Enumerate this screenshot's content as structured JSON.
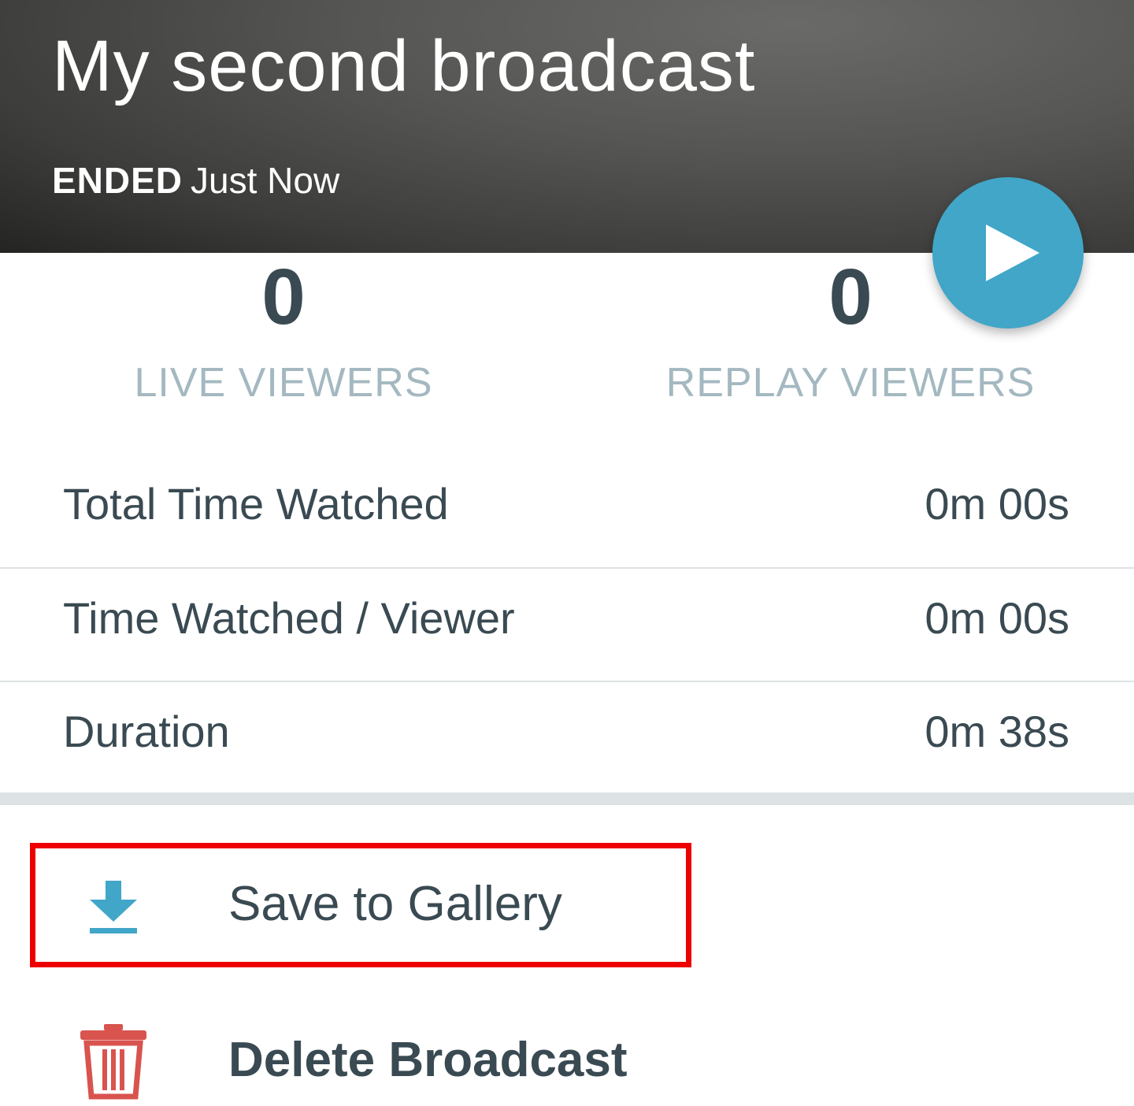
{
  "header": {
    "title": "My second broadcast",
    "status": "ENDED",
    "time": "Just Now",
    "play_icon": "play-icon"
  },
  "stats": {
    "live": {
      "value": "0",
      "label": "LIVE VIEWERS"
    },
    "replay": {
      "value": "0",
      "label": "REPLAY VIEWERS"
    }
  },
  "metrics": [
    {
      "label": "Total Time Watched",
      "value": "0m 00s"
    },
    {
      "label": "Time Watched / Viewer",
      "value": "0m 00s"
    },
    {
      "label": "Duration",
      "value": "0m 38s"
    }
  ],
  "actions": {
    "save": {
      "label": "Save to Gallery",
      "icon": "download-icon"
    },
    "delete": {
      "label": "Delete Broadcast",
      "icon": "trash-icon"
    }
  },
  "colors": {
    "accent": "#41a6c8",
    "danger": "#d9534f",
    "highlight": "#ee0000"
  }
}
